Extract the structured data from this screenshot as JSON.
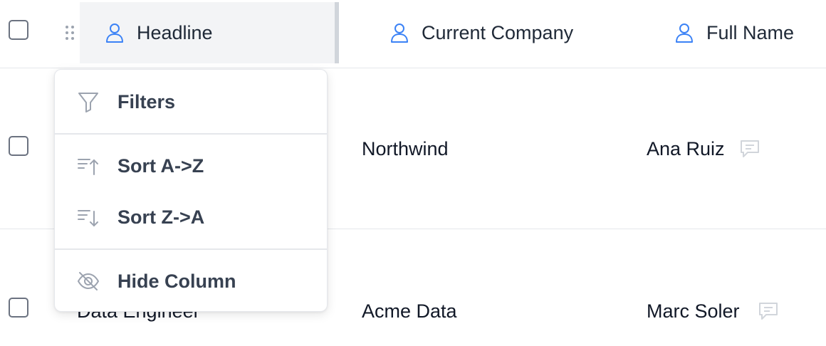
{
  "header": {
    "columns": [
      {
        "label": "Headline",
        "icon": "user-icon"
      },
      {
        "label": "Current Company",
        "icon": "user-icon"
      },
      {
        "label": "Full Name",
        "icon": "user-icon"
      }
    ]
  },
  "rows": [
    {
      "headline": "",
      "company": "Northwind",
      "full_name": "Ana Ruiz"
    },
    {
      "headline": "Data Engineer",
      "company": "Acme Data",
      "full_name": "Marc Soler"
    }
  ],
  "column_menu": {
    "items": [
      {
        "label": "Filters",
        "icon": "filter-icon"
      },
      {
        "label": "Sort A->Z",
        "icon": "sort-ascending-icon"
      },
      {
        "label": "Sort Z->A",
        "icon": "sort-descending-icon"
      },
      {
        "label": "Hide Column",
        "icon": "eye-off-icon"
      }
    ]
  },
  "colors": {
    "accent_icon": "#3b82f6",
    "text_primary": "#1f2937",
    "menu_text": "#374151",
    "muted_icon": "#9ca3af",
    "border": "#e5e7eb"
  }
}
